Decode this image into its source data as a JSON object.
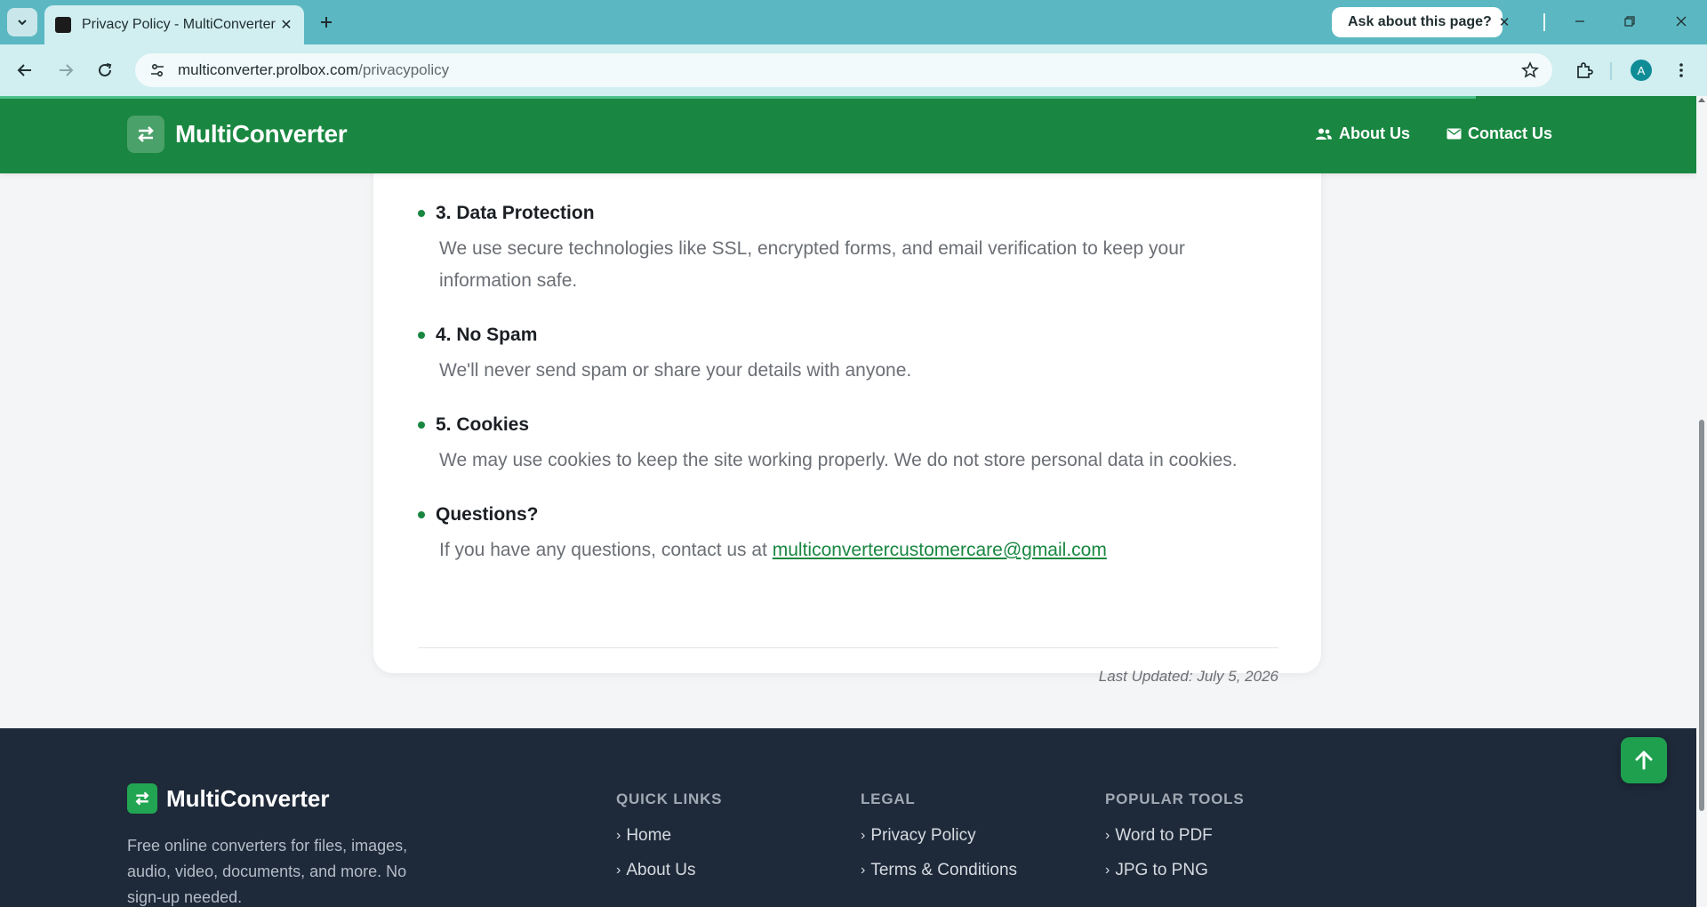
{
  "browser": {
    "tab_title": "Privacy Policy - MultiConverter",
    "ask_label": "Ask about this page?",
    "url_host": "multiconverter.prolbox.com",
    "url_path": "/privacypolicy",
    "avatar_letter": "A"
  },
  "header": {
    "brand": "MultiConverter",
    "nav": [
      {
        "label": "About Us",
        "icon": "users-icon"
      },
      {
        "label": "Contact Us",
        "icon": "envelope-icon"
      }
    ]
  },
  "policy": {
    "sections": [
      {
        "title": "3. Data Protection",
        "body": "We use secure technologies like SSL, encrypted forms, and email verification to keep your information safe."
      },
      {
        "title": "4. No Spam",
        "body": "We'll never send spam or share your details with anyone."
      },
      {
        "title": "5. Cookies",
        "body": "We may use cookies to keep the site working properly. We do not store personal data in cookies."
      },
      {
        "title": "Questions?",
        "body": "If you have any questions, contact us at ",
        "email": "multiconvertercustomercare@gmail.com"
      }
    ],
    "last_updated": "Last Updated: July 5, 2026"
  },
  "footer": {
    "brand": "MultiConverter",
    "description": "Free online converters for files, images, audio, video, documents, and more. No sign-up needed.",
    "columns": [
      {
        "heading": "QUICK LINKS",
        "items": [
          "Home",
          "About Us"
        ]
      },
      {
        "heading": "LEGAL",
        "items": [
          "Privacy Policy",
          "Terms & Conditions"
        ]
      },
      {
        "heading": "POPULAR TOOLS",
        "items": [
          "Word to PDF",
          "JPG to PNG"
        ]
      }
    ]
  },
  "colors": {
    "brand_green": "#198741",
    "browser_teal": "#5bb8c2",
    "footer_bg": "#1e2939"
  }
}
